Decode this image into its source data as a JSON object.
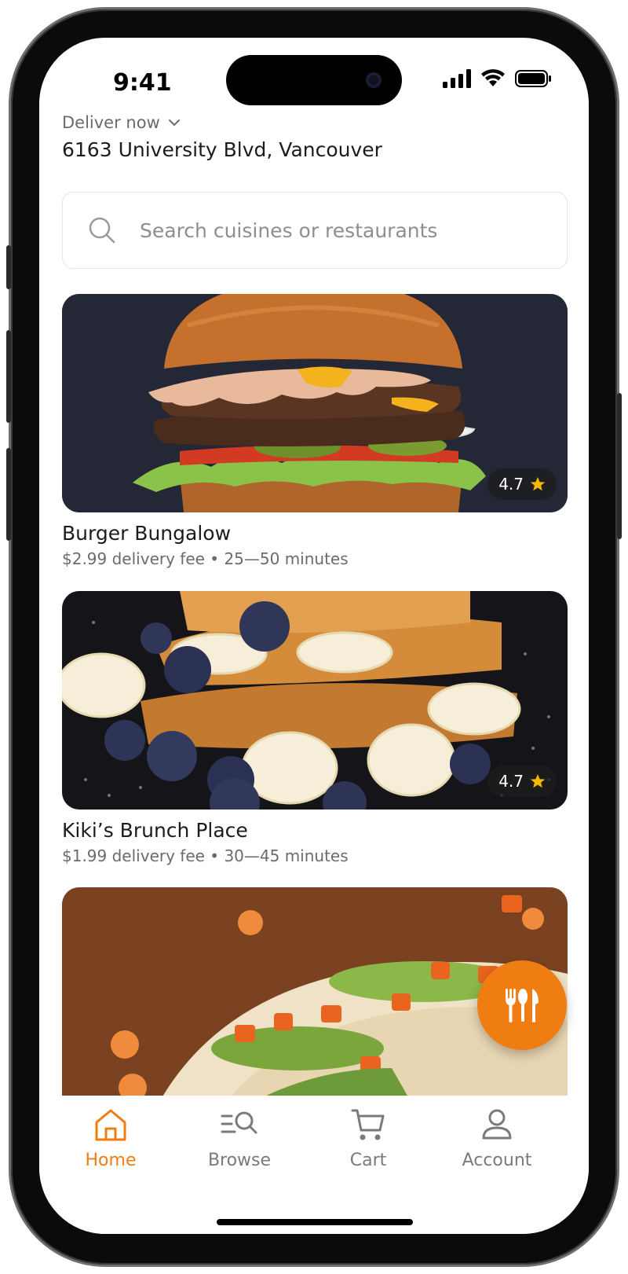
{
  "status_bar": {
    "time": "9:41"
  },
  "header": {
    "deliver_label": "Deliver now",
    "address": "6163 University Blvd, Vancouver"
  },
  "search": {
    "placeholder": "Search cuisines or restaurants"
  },
  "restaurants": [
    {
      "name": "Burger Bungalow",
      "meta": "$2.99 delivery fee • 25—50 minutes",
      "rating": "4.7"
    },
    {
      "name": "Kiki’s Brunch Place",
      "meta": "$1.99 delivery fee • 30—45 minutes",
      "rating": "4.7"
    },
    {
      "name": "",
      "meta": "",
      "rating": ""
    }
  ],
  "tabs": [
    {
      "label": "Home",
      "icon": "home-icon",
      "active": true
    },
    {
      "label": "Browse",
      "icon": "browse-icon",
      "active": false
    },
    {
      "label": "Cart",
      "icon": "cart-icon",
      "active": false
    },
    {
      "label": "Account",
      "icon": "account-icon",
      "active": false
    }
  ],
  "colors": {
    "accent": "#ef7d12",
    "star": "#f5b800"
  }
}
